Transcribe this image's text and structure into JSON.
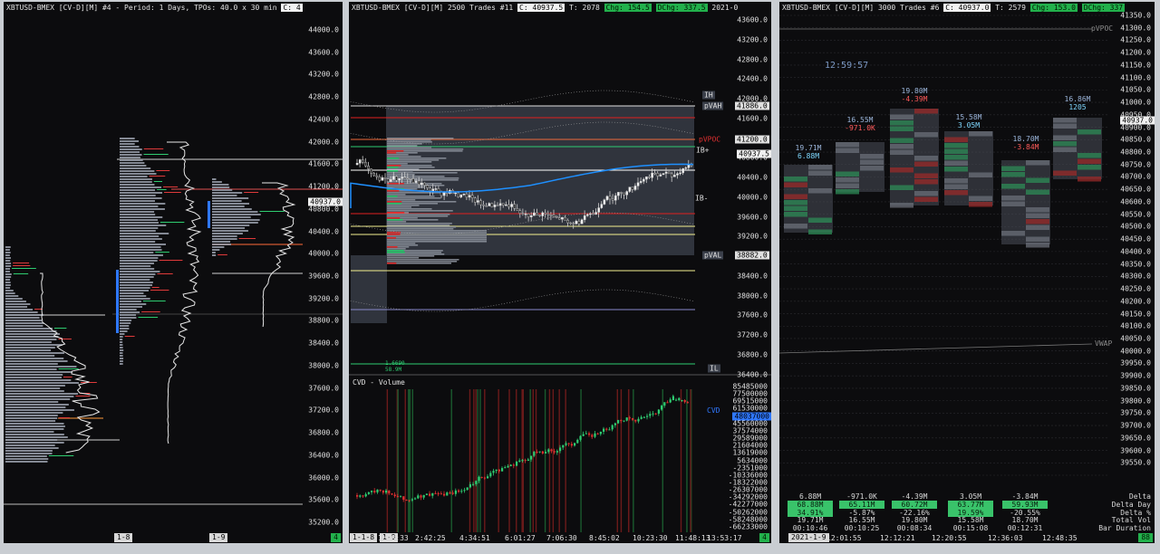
{
  "colors": {
    "bg": "#0c0c0e",
    "up": "#2ecc71",
    "down": "#e03030",
    "vwap": "#1e90ff",
    "poc": "#ffffff"
  },
  "left": {
    "header": "XBTUSD-BMEX [CV-D][M]  #4 - Period: 1 Days, TPOs: 40.0 x 30 min",
    "price_box": "C: 4",
    "last_price": "40937.0",
    "ticks": [
      "44000.0",
      "43600.0",
      "43200.0",
      "42800.0",
      "42400.0",
      "42000.0",
      "41600.0",
      "41200.0",
      "40800.0",
      "40400.0",
      "40000.0",
      "39600.0",
      "39200.0",
      "38800.0",
      "38400.0",
      "38000.0",
      "37600.0",
      "37200.0",
      "36800.0",
      "36400.0",
      "36000.0",
      "35600.0",
      "35200.0"
    ],
    "footer": {
      "s1": "1-8",
      "s2": "1-9",
      "right": "4"
    }
  },
  "middle": {
    "header": {
      "title": "XBTUSD-BMEX [CV-D][M]  2500 Trades  #11",
      "close": "C: 40937.5",
      "total": "T: 2078",
      "chg": "Chg: 154.5",
      "dchg": "DChg: 337.5",
      "date": "2021-0"
    },
    "last_price": "40937.5",
    "ticks": [
      "43600.0",
      "43200.0",
      "42800.0",
      "42400.0",
      "42000.0",
      "41600.0",
      "41200.0",
      "40800.0",
      "40400.0",
      "40000.0",
      "39600.0",
      "39200.0",
      "38800.0",
      "38400.0",
      "38000.0",
      "37600.0",
      "37200.0",
      "36800.0",
      "36400.0"
    ],
    "tags": {
      "ih": "IH",
      "pvah": "pVAH",
      "pvah_v": "41886.0",
      "pvpoc": "pVPOC",
      "pvpoc_v": "41200.0",
      "ibp": "IB+",
      "ibm": "IB-",
      "pval": "pVAL",
      "pval_v": "38882.0",
      "il": "IL"
    },
    "cvd_label": "CVD - Volume",
    "cvd_tag": "CVD",
    "cvd_ticks": [
      "85485000",
      "77500000",
      "69515000",
      "61530000",
      "53545000",
      "45560000",
      "37574000",
      "29589000",
      "21604000",
      "13619000",
      "5634000",
      "-2351000",
      "-10336000",
      "-18322000",
      "-26307000",
      "-34292000",
      "-42277000",
      "-50262000",
      "-58248000",
      "-66233000"
    ],
    "cvd_value": "48037000",
    "delta_small": {
      "a": "1.6690",
      "b": "58.9M"
    },
    "footer": {
      "s1": "1-1-8",
      "s2": "1-9",
      "times": [
        "1:08:33",
        "2:42:25",
        "4:34:51",
        "6:01:27",
        "7:06:30",
        "8:45:02",
        "10:23:30",
        "11:48:13",
        "13:53:17"
      ],
      "right": "4"
    }
  },
  "right": {
    "header": {
      "title": "XBTUSD-BMEX [CV-D][M]  3000 Trades  #6",
      "close": "C: 40937.0",
      "total": "T: 2579",
      "chg": "Chg: 153.0",
      "dchg": "DChg: 337"
    },
    "clock": "12:59:57",
    "pvpoc": "pVPOC",
    "vwap": "VWAP",
    "last_price": "40937.0",
    "ticks": [
      "41350.0",
      "41300.0",
      "41250.0",
      "41200.0",
      "41150.0",
      "41100.0",
      "41050.0",
      "41000.0",
      "40950.0",
      "40900.0",
      "40850.0",
      "40800.0",
      "40750.0",
      "40700.0",
      "40650.0",
      "40600.0",
      "40550.0",
      "40500.0",
      "40450.0",
      "40400.0",
      "40350.0",
      "40300.0",
      "40250.0",
      "40200.0",
      "40150.0",
      "40100.0",
      "40050.0",
      "40000.0",
      "39950.0",
      "39900.0",
      "39850.0",
      "39800.0",
      "39750.0",
      "39700.0",
      "39650.0",
      "39600.0",
      "39550.0"
    ],
    "bars": [
      {
        "vol": "19.71M",
        "delta": "6.88M",
        "neg": false
      },
      {
        "vol": "16.55M",
        "delta": "-971.0K",
        "neg": true
      },
      {
        "vol": "19.80M",
        "delta": "-4.39M",
        "neg": true
      },
      {
        "vol": "15.58M",
        "delta": "3.05M",
        "neg": false
      },
      {
        "vol": "18.70M",
        "delta": "-3.84M",
        "neg": true
      },
      {
        "vol": "16.86M",
        "delta": "1205",
        "neg": false
      }
    ],
    "stats": {
      "labels": [
        "Delta",
        "Delta Day",
        "Delta %",
        "Total Vol",
        "Bar Duration"
      ],
      "delta": [
        "6.88M",
        "-971.0K",
        "-4.39M",
        "3.05M",
        "-3.84M"
      ],
      "delta_day": [
        "68.88M",
        "65.11M",
        "60.72M",
        "63.77M",
        "59.93M"
      ],
      "delta_pct": [
        "34.91%",
        "-5.87%",
        "-22.16%",
        "19.59%",
        "-20.55%"
      ],
      "total_vol": [
        "19.71M",
        "16.55M",
        "19.80M",
        "15.58M",
        "18.70M"
      ],
      "bar_dur": [
        "00:10:46",
        "00:10:25",
        "00:08:34",
        "00:15:08",
        "00:12:31"
      ]
    },
    "footer": {
      "s1": "2021-1-9",
      "times": [
        "12:01:55",
        "12:12:21",
        "12:20:55",
        "12:36:03",
        "12:48:35"
      ],
      "right": "88"
    }
  }
}
